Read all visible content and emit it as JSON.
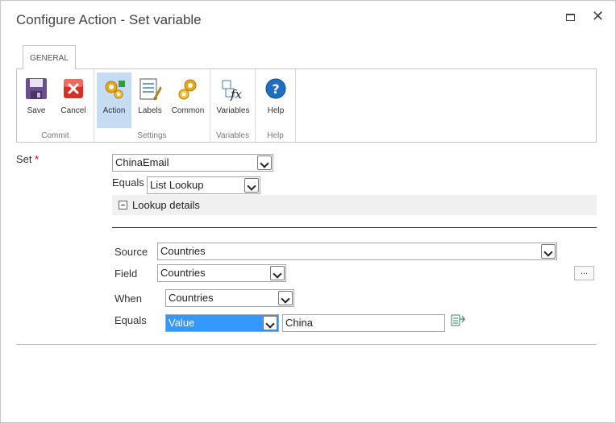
{
  "window": {
    "title": "Configure Action - Set variable"
  },
  "ribbon": {
    "tab": "GENERAL",
    "groups": [
      {
        "label": "Commit",
        "buttons": [
          {
            "label": "Save",
            "icon": "floppy-disk-icon"
          },
          {
            "label": "Cancel",
            "icon": "cancel-icon"
          }
        ]
      },
      {
        "label": "Settings",
        "buttons": [
          {
            "label": "Action",
            "icon": "gears-icon",
            "active": true
          },
          {
            "label": "Labels",
            "icon": "labels-icon"
          },
          {
            "label": "Common",
            "icon": "gears-icon"
          }
        ]
      },
      {
        "label": "Variables",
        "buttons": [
          {
            "label": "Variables",
            "icon": "fx-icon"
          }
        ]
      },
      {
        "label": "Help",
        "buttons": [
          {
            "label": "Help",
            "icon": "help-icon"
          }
        ]
      }
    ]
  },
  "form": {
    "set_label": "Set",
    "required_mark": "*",
    "set_value": "ChinaEmail",
    "equals_label": "Equals",
    "equals_value": "List Lookup",
    "lookup_label": "Lookup details",
    "source_label": "Source",
    "source_value": "Countries",
    "field_label": "Field",
    "field_value": "Countries",
    "ellipsis": "...",
    "when_label": "When",
    "when_value": "Countries",
    "equals2_label": "Equals",
    "equals2_value": "Value",
    "equals2_text": "China"
  },
  "colors": {
    "active_button": "#c5dcf2",
    "selected_dropdown": "#3399ff",
    "help_icon": "#1e6fbf"
  }
}
